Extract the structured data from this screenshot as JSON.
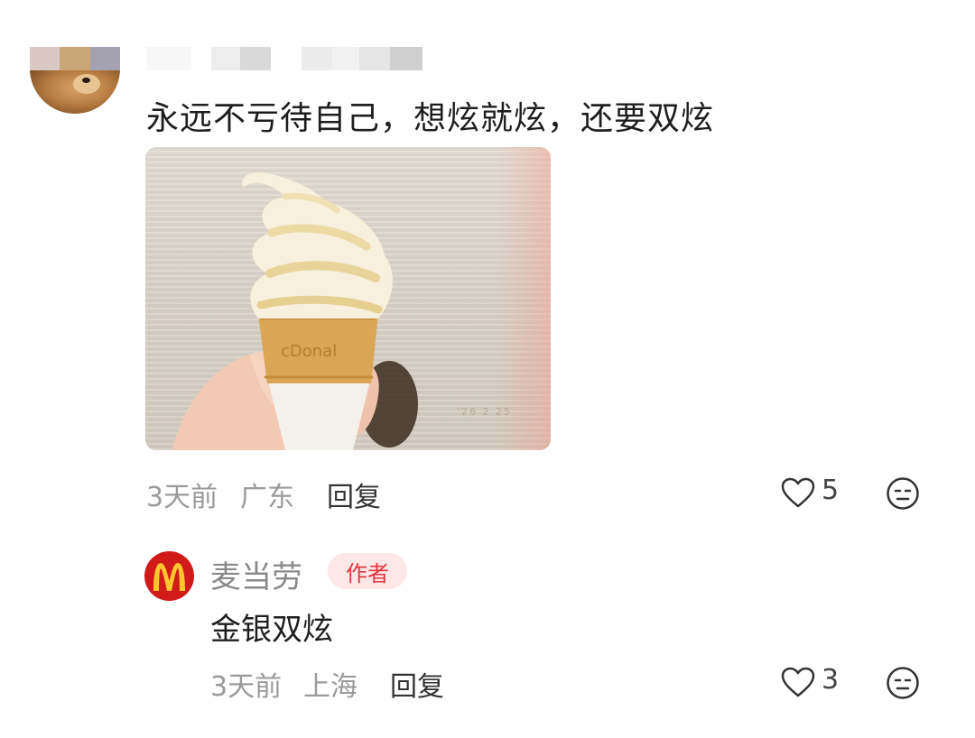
{
  "comment": {
    "text": "永远不亏待自己，想炫就炫，还要双炫",
    "time": "3天前",
    "location": "广东",
    "reply_label": "回复",
    "likes": "5",
    "photo": {
      "cone_text": "cDonal",
      "timestamp": "'26  2 25"
    }
  },
  "reply": {
    "author": "麦当劳",
    "badge": "作者",
    "text": "金银双炫",
    "time": "3天前",
    "location": "上海",
    "reply_label": "回复",
    "likes": "3"
  },
  "colors": {
    "badge_bg": "#fde7e7",
    "badge_text": "#e0383e",
    "mcd_red": "#d11a1a",
    "mcd_yellow": "#ffc72c",
    "meta_gray": "#9a9a9a"
  },
  "icons": [
    "heart-icon",
    "face-icon",
    "mcdonalds-logo"
  ]
}
